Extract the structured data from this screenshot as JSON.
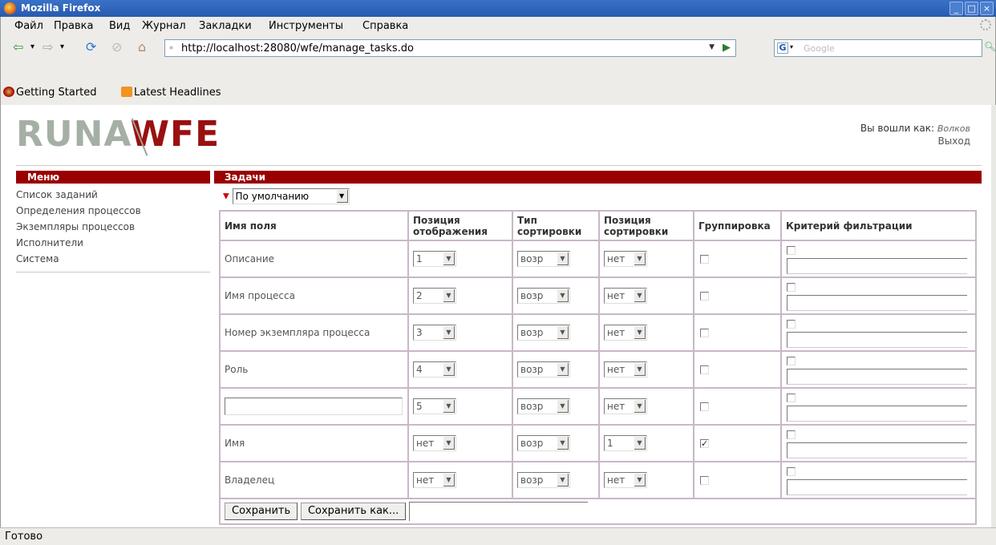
{
  "window": {
    "title": "Mozilla Firefox",
    "buttons": [
      "_",
      "□",
      "×"
    ]
  },
  "menubar": {
    "items": [
      "Файл",
      "Правка",
      "Вид",
      "Журнал",
      "Закладки",
      "Инструменты",
      "Справка"
    ]
  },
  "navbar": {
    "url": "http://localhost:28080/wfe/manage_tasks.do",
    "search_placeholder": "Google"
  },
  "bookmarks": {
    "items": [
      "Getting Started",
      "Latest Headlines"
    ]
  },
  "header": {
    "logo_part1": "RUNA",
    "logo_part2": "WFE",
    "logged_in_label": "Вы вошли как:",
    "username": "Волков",
    "logout": "Выход"
  },
  "menu": {
    "title": "Меню",
    "items": [
      "Список заданий",
      "Определения процессов",
      "Экземпляры процессов",
      "Исполнители",
      "Система"
    ]
  },
  "tasks": {
    "title": "Задачи",
    "preset": "По умолчанию",
    "columns": {
      "field": "Имя поля",
      "display_pos_1": "Позиция",
      "display_pos_2": "отображения",
      "sort_type_1": "Тип",
      "sort_type_2": "сортировки",
      "sort_pos_1": "Позиция",
      "sort_pos_2": "сортировки",
      "grouping": "Группировка",
      "filter": "Критерий фильтрации"
    },
    "rows": [
      {
        "name": "Описание",
        "display": "1",
        "sort_type": "возр",
        "sort_pos": "нет",
        "grouped": ""
      },
      {
        "name": "Имя процесса",
        "display": "2",
        "sort_type": "возр",
        "sort_pos": "нет",
        "grouped": ""
      },
      {
        "name": "Номер экземпляра процесса",
        "display": "3",
        "sort_type": "возр",
        "sort_pos": "нет",
        "grouped": ""
      },
      {
        "name": "Роль",
        "display": "4",
        "sort_type": "возр",
        "sort_pos": "нет",
        "grouped": ""
      },
      {
        "name": "",
        "display": "5",
        "sort_type": "возр",
        "sort_pos": "нет",
        "grouped": ""
      },
      {
        "name": "Имя",
        "display": "нет",
        "sort_type": "возр",
        "sort_pos": "1",
        "grouped": "✓"
      },
      {
        "name": "Владелец",
        "display": "нет",
        "sort_type": "возр",
        "sort_pos": "нет",
        "grouped": ""
      }
    ],
    "save_label": "Сохранить",
    "save_as_label": "Сохранить как..."
  },
  "status": {
    "text": "Готово"
  }
}
